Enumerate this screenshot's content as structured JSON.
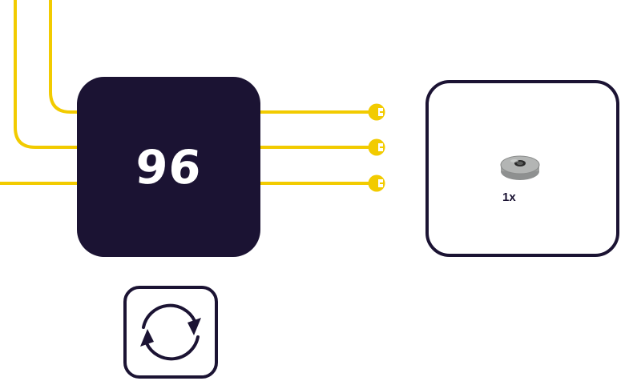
{
  "step": {
    "number": "96"
  },
  "parts": [
    {
      "quantity": "1x",
      "icon": "round-tile-gray-part"
    }
  ],
  "controls": {
    "rotate_icon": "rotate-icon"
  },
  "colors": {
    "wire": "#f2cb00",
    "box": "#1b1333",
    "part": "#b3b5b4"
  }
}
